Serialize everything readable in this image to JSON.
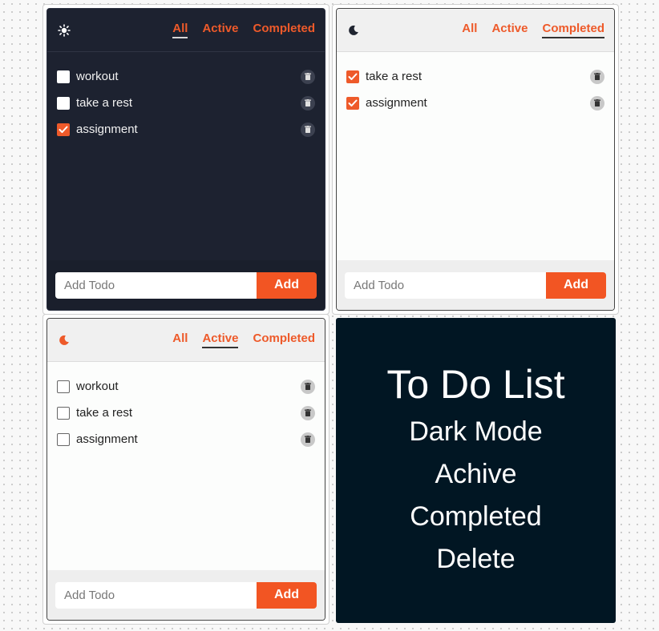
{
  "colors": {
    "accent": "#ee5a2a",
    "dark_bg": "#1d2230",
    "promo_bg": "#011623"
  },
  "panels": [
    {
      "theme": "dark",
      "mode_icon": "sun-icon",
      "tabs": [
        {
          "label": "All",
          "active": true
        },
        {
          "label": "Active",
          "active": false
        },
        {
          "label": "Completed",
          "active": false
        }
      ],
      "todos": [
        {
          "text": "workout",
          "checked": false
        },
        {
          "text": "take a rest",
          "checked": false
        },
        {
          "text": "assignment",
          "checked": true
        }
      ],
      "input_placeholder": "Add Todo",
      "add_label": "Add"
    },
    {
      "theme": "light",
      "mode_icon": "moon-icon",
      "tabs": [
        {
          "label": "All",
          "active": false
        },
        {
          "label": "Active",
          "active": false
        },
        {
          "label": "Completed",
          "active": true
        }
      ],
      "todos": [
        {
          "text": "take a rest",
          "checked": true
        },
        {
          "text": "assignment",
          "checked": true
        }
      ],
      "input_placeholder": "Add Todo",
      "add_label": "Add"
    },
    {
      "theme": "light",
      "mode_icon": "moon-icon",
      "mode_icon_color": "#ee5a2a",
      "tabs": [
        {
          "label": "All",
          "active": false
        },
        {
          "label": "Active",
          "active": true
        },
        {
          "label": "Completed",
          "active": false
        }
      ],
      "todos": [
        {
          "text": "workout",
          "checked": false
        },
        {
          "text": "take a rest",
          "checked": false
        },
        {
          "text": "assignment",
          "checked": false
        }
      ],
      "input_placeholder": "Add Todo",
      "add_label": "Add"
    }
  ],
  "promo": {
    "title": "To Do List",
    "lines": [
      "Dark Mode",
      "Achive",
      "Completed",
      "Delete"
    ]
  }
}
